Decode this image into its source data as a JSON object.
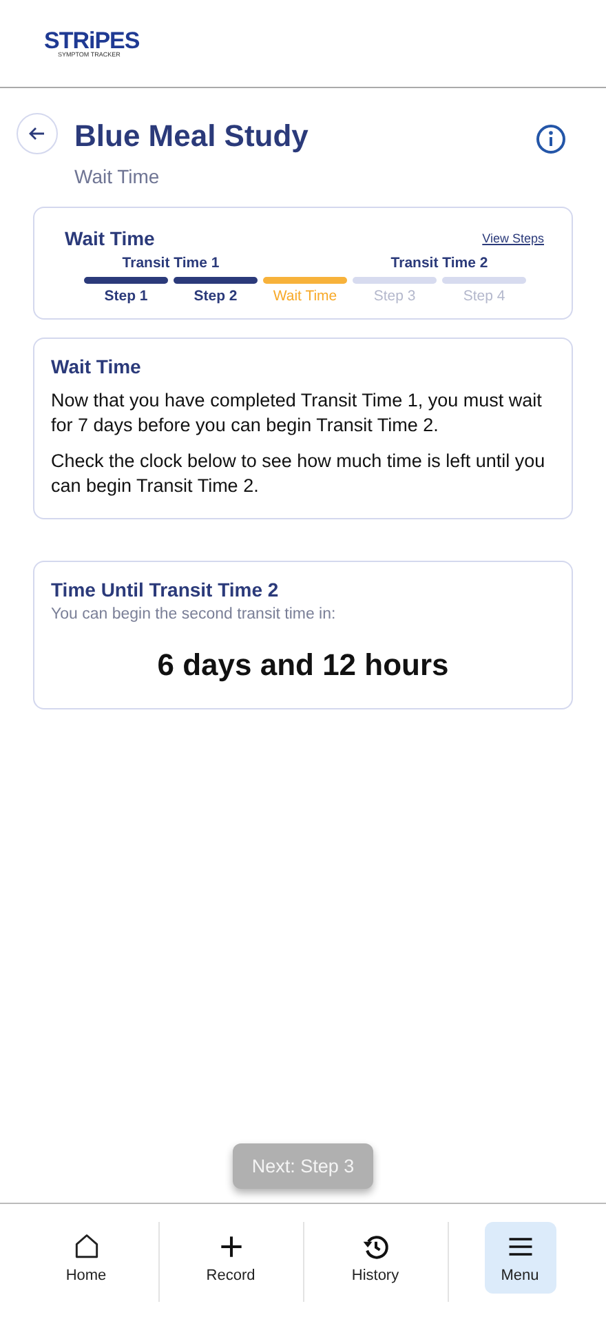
{
  "logo": {
    "name": "STRiPES",
    "tagline": "SYMPTOM TRACKER"
  },
  "header": {
    "title": "Blue Meal Study",
    "subtitle": "Wait Time"
  },
  "progress_card": {
    "title": "Wait Time",
    "link": "View Steps",
    "phases": [
      {
        "label": "Transit Time 1",
        "steps": [
          {
            "label": "Step 1",
            "kind": "done"
          },
          {
            "label": "Step 2",
            "kind": "done"
          }
        ]
      },
      {
        "steps": [
          {
            "label": "Wait Time",
            "kind": "current"
          }
        ]
      },
      {
        "label": "Transit Time 2",
        "steps": [
          {
            "label": "Step 3",
            "kind": "upcoming"
          },
          {
            "label": "Step 4",
            "kind": "upcoming"
          }
        ]
      }
    ]
  },
  "info_card": {
    "title": "Wait Time",
    "paragraphs": [
      "Now that you have completed Transit Time 1, you must wait for 7 days before you can begin Transit Time 2.",
      "Check the clock below to see how much time is left until you can begin Transit Time 2."
    ]
  },
  "countdown_card": {
    "title": "Time Until Transit Time 2",
    "caption": "You can begin the second transit time in:",
    "value": "6 days and 12 hours"
  },
  "next_button": {
    "label": "Next: Step 3",
    "disabled": true
  },
  "nav": [
    {
      "kind": "home",
      "label": "Home",
      "selected": false
    },
    {
      "kind": "record",
      "label": "Record",
      "selected": false
    },
    {
      "kind": "history",
      "label": "History",
      "selected": false
    },
    {
      "kind": "menu",
      "label": "Menu",
      "selected": true
    }
  ]
}
